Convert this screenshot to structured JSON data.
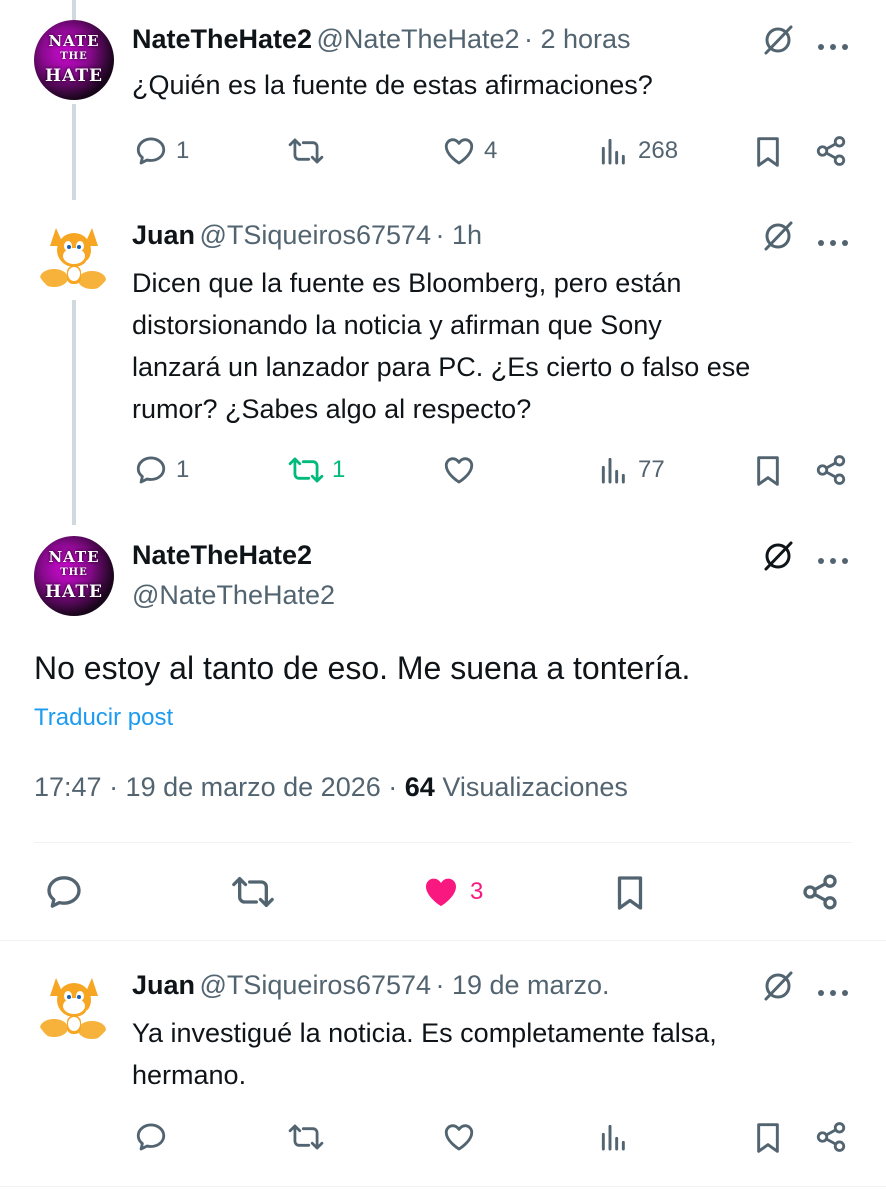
{
  "tweet1": {
    "name": "NateTheHate2",
    "handle": "@NateTheHate2",
    "time": "· 2 horas",
    "text": "¿Quién es la fuente de estas afirmaciones?",
    "replies": "1",
    "likes": "4",
    "views": "268"
  },
  "tweet2": {
    "name": "Juan",
    "handle": "@TSiqueiros67574",
    "time": "· 1h",
    "lines": [
      "Dicen que la fuente es Bloomberg, pero están",
      "distorsionando la noticia y afirman que Sony",
      "lanzará un lanzador para PC. ¿Es cierto o falso ese",
      "rumor? ¿Sabes algo al respecto?"
    ],
    "replies": "1",
    "reposts": "1",
    "views": "77"
  },
  "main": {
    "name": "NateTheHate2",
    "handle": "@NateTheHate2",
    "text": "No estoy al tanto de eso. Me suena a tontería.",
    "translate": "Traducir post",
    "timestamp": "17:47 · 19 de marzo de 2026 ·",
    "views_count": "64",
    "views_label": "Visualizaciones",
    "likes": "3"
  },
  "tweet4": {
    "name": "Juan",
    "handle": "@TSiqueiros67574",
    "time": "· 19 de marzo.",
    "lines": [
      "Ya investigué la noticia. Es completamente falsa,",
      "hermano."
    ]
  },
  "avatar_text": {
    "nate_line1": "NATE",
    "nate_line2": "THE",
    "nate_line3": "HATE"
  },
  "colors": {
    "gray": "#536471",
    "green": "#00ba7c",
    "pink": "#f91880",
    "link": "#1d9bf0"
  }
}
